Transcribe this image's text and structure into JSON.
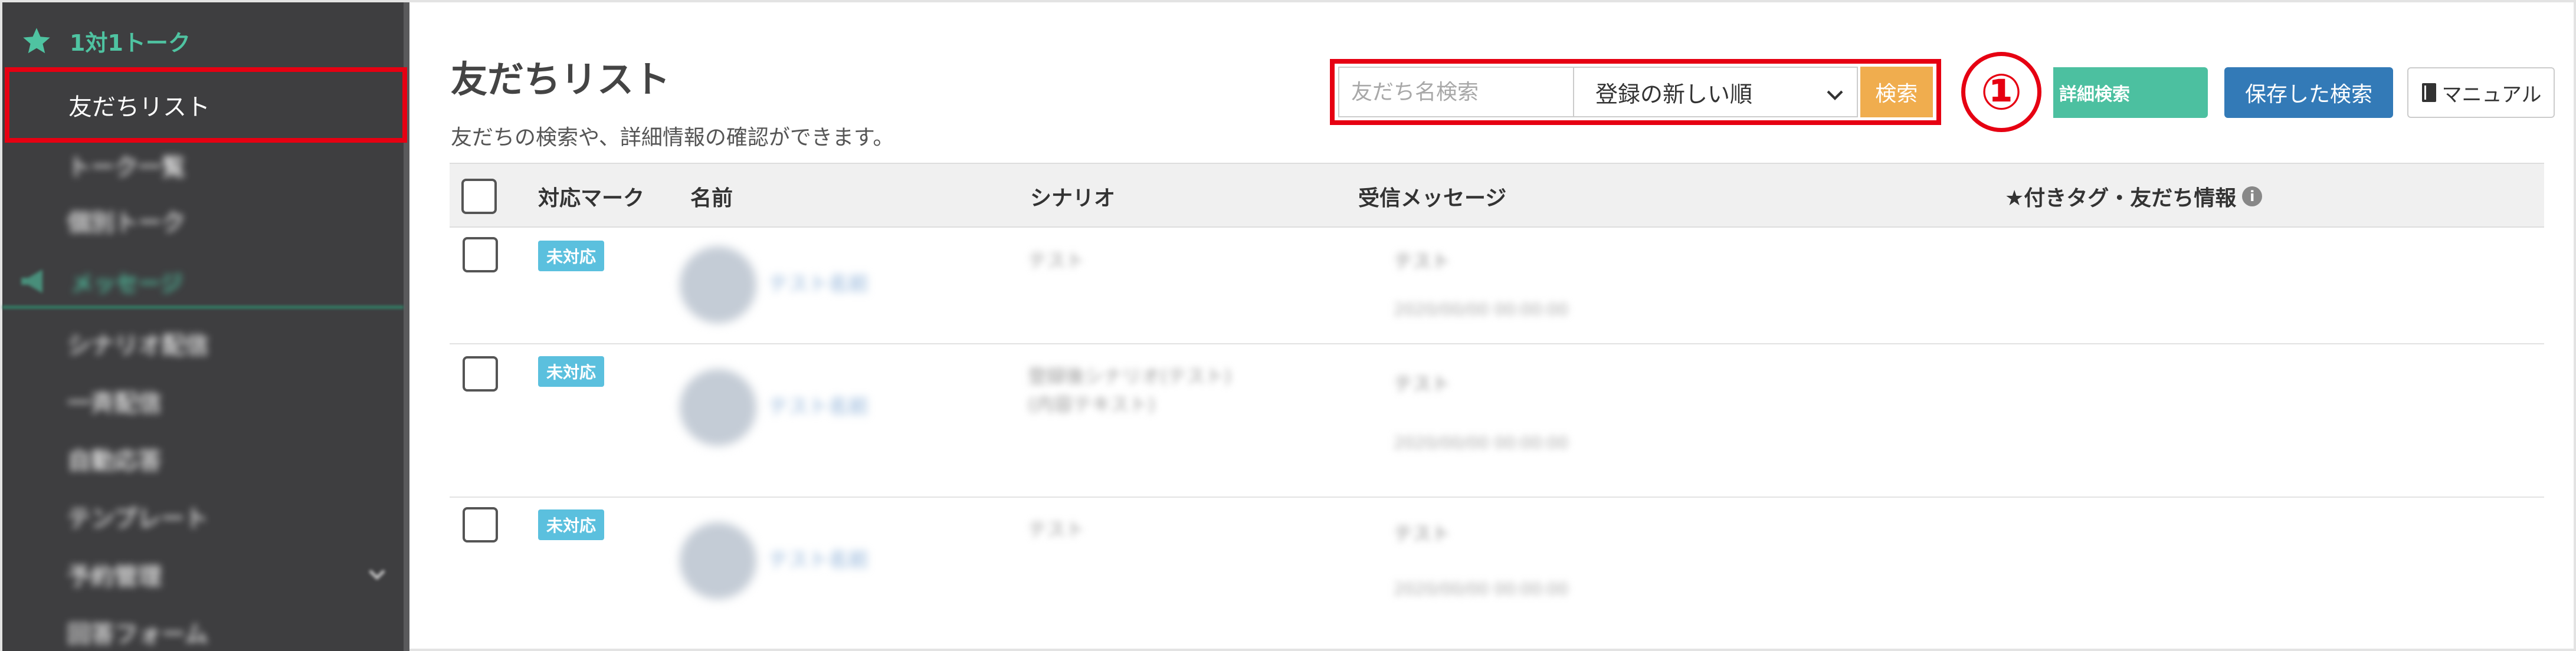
{
  "sidebar": {
    "section1": {
      "label": "1対1トーク",
      "icon": "star-icon"
    },
    "items1": [
      {
        "label": "友だちリスト"
      },
      {
        "label": "トーク一覧"
      },
      {
        "label": "個別トーク"
      }
    ],
    "section2": {
      "label": "メッセージ",
      "icon": "megaphone-icon"
    },
    "items2": [
      {
        "label": "シナリオ配信"
      },
      {
        "label": "一斉配信"
      },
      {
        "label": "自動応答"
      },
      {
        "label": "テンプレート"
      },
      {
        "label": "予約管理"
      },
      {
        "label": "回答フォーム"
      }
    ]
  },
  "header": {
    "title": "友だちリスト",
    "description": "友だちの検索や、詳細情報の確認ができます。"
  },
  "search": {
    "placeholder": "友だち名検索",
    "sort_value": "登録の新しい順",
    "button": "検索",
    "marker": "①"
  },
  "actions": {
    "detail_search": "詳細検索",
    "saved_search": "保存した検索",
    "manual": "マニュアル"
  },
  "table": {
    "headers": [
      "対応マーク",
      "名前",
      "シナリオ",
      "受信メッセージ",
      "★付きタグ・友だち情報"
    ],
    "rows": [
      {
        "status": "未対応",
        "name": "テスト名前",
        "scenario": "テスト",
        "message": "テスト",
        "date": "2020/00/00 00:00:00"
      },
      {
        "status": "未対応",
        "name": "テスト名前",
        "scenario": "登録後シナリオ(テスト)",
        "scenario2": "(内容テキスト)",
        "message": "テスト",
        "date": "2020/00/00 00:00:00"
      },
      {
        "status": "未対応",
        "name": "テスト名前",
        "scenario": "テスト",
        "message": "テスト",
        "date": "2020/00/00 00:00:00"
      }
    ]
  },
  "colors": {
    "sidebar_bg": "#3e3e40",
    "accent_green": "#4fc3a1",
    "highlight_red": "#e60012",
    "search_orange": "#f0ad4e",
    "saved_blue": "#337ab7",
    "badge_blue": "#5bc0de"
  }
}
